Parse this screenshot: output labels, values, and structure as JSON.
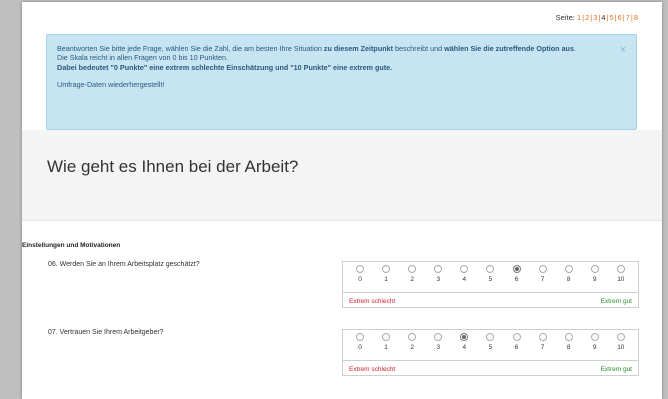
{
  "pager": {
    "label": "Seite:",
    "pages": [
      "1",
      "2",
      "3",
      "4",
      "5",
      "6",
      "7",
      "8"
    ],
    "current": "4"
  },
  "alert": {
    "line1_a": "Beantworten Sie bitte jede Frage, wählen Sie die Zahl, die am besten Ihre Situation ",
    "line1_b": "zu diesem Zeitpunkt",
    "line1_c": " beschreibt und ",
    "line1_d": "wählen Sie die zutreffende Option aus",
    "line1_e": ".",
    "line2": "Die Skala reicht in allen Fragen von 0 bis 10 Punkten.",
    "line3": "Dabei bedeutet \"0 Punkte\" eine extrem schlechte Einschätzung und \"10 Punkte\" eine extrem gute.",
    "restored": "Umfrage-Daten wiederhergestellt!",
    "close": "×"
  },
  "section": {
    "title": "Wie geht es Ihnen bei der Arbeit?"
  },
  "group": {
    "title": "Einstellungen und Motivationen"
  },
  "questions": [
    {
      "text": "06. Werden Sie an Ihrem Arbeitsplatz geschätzt?",
      "selected": 6,
      "low_label": "Extrem schlecht",
      "high_label": "Extrem gut"
    },
    {
      "text": "07. Vertrauen Sie Ihrem Arbeitgeber?",
      "selected": 4,
      "low_label": "Extrem schlecht",
      "high_label": "Extrem gut"
    }
  ],
  "scale_values": [
    "0",
    "1",
    "2",
    "3",
    "4",
    "5",
    "6",
    "7",
    "8",
    "9",
    "10"
  ],
  "colors": {
    "alert_bg": "#c7e4f3",
    "pager_link": "#e07020",
    "low": "#d0202a",
    "high": "#2a8c2a"
  }
}
